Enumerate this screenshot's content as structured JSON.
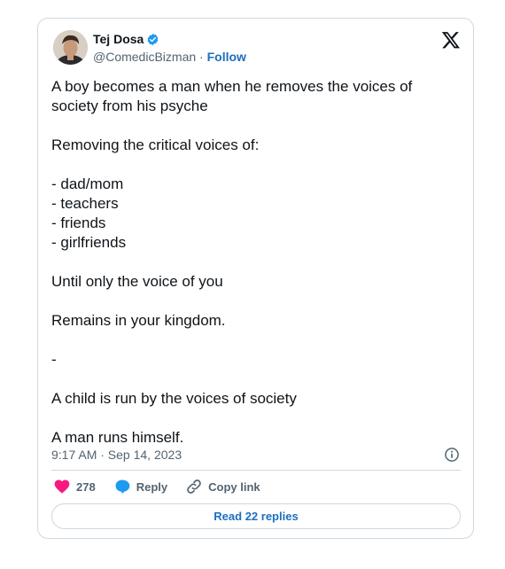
{
  "author": {
    "name": "Tej Dosa",
    "handle": "@ComedicBizman",
    "separator": "·",
    "follow_label": "Follow",
    "verified_color": "#1d9bf0"
  },
  "platform_icon": "x-logo-icon",
  "tweet": {
    "text": "A boy becomes a man when he removes the voices of society from his psyche\n\nRemoving the critical voices of:\n\n- dad/mom\n- teachers\n- friends\n- girlfriends\n\nUntil only the voice of you\n\nRemains in your kingdom.\n\n-\n\nA child is run by the voices of society\n\nA man runs himself."
  },
  "meta": {
    "timestamp": "9:17 AM · Sep 14, 2023",
    "info_icon": "info-icon"
  },
  "actions": {
    "like_count": "278",
    "reply_label": "Reply",
    "copy_label": "Copy link",
    "like_color": "#f91880",
    "reply_color": "#1d9bf0"
  },
  "read_replies_label": "Read 22 replies"
}
